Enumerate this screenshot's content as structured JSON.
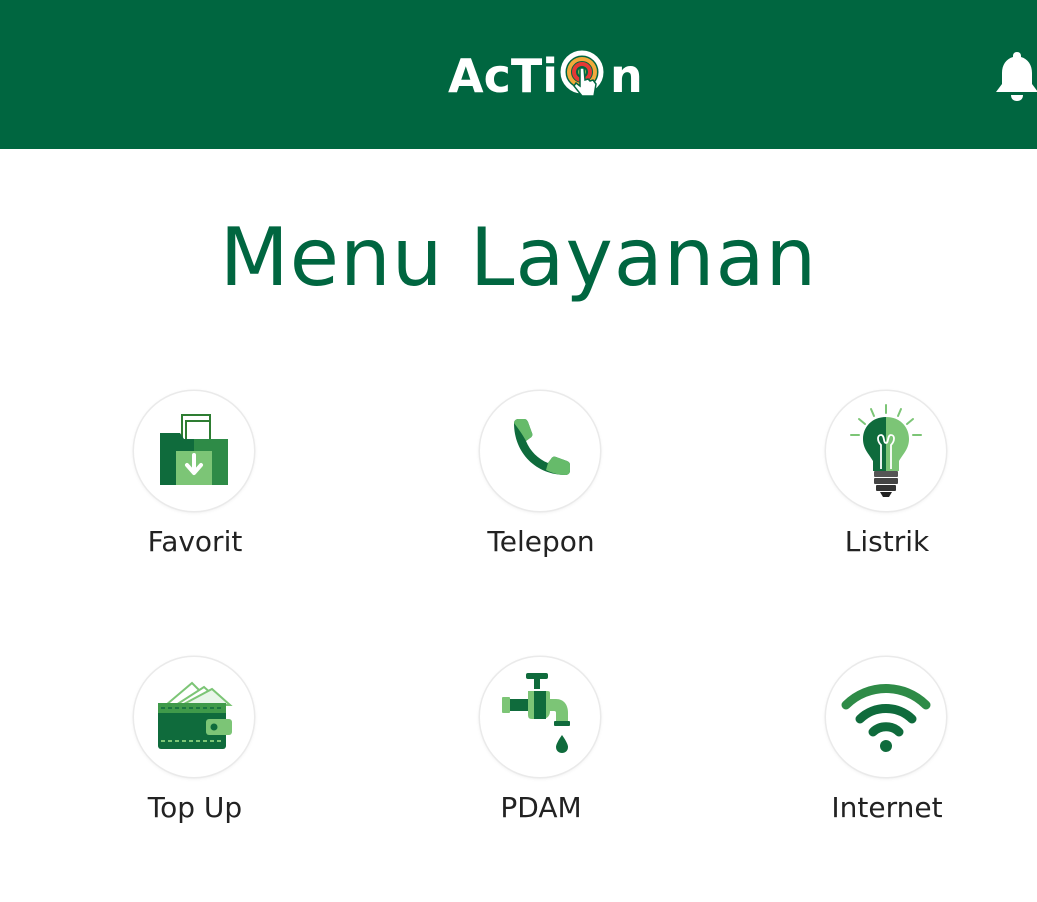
{
  "header": {
    "logo_text_start": "AcTi",
    "logo_text_end": "n",
    "brand_color": "#006640",
    "logo_icon": "target-hand-icon",
    "notification_icon": "bell-icon"
  },
  "page": {
    "title": "Menu Layanan"
  },
  "menu": {
    "items": [
      {
        "label": "Favorit",
        "icon": "folder-download-icon"
      },
      {
        "label": "Telepon",
        "icon": "phone-icon"
      },
      {
        "label": "Listrik",
        "icon": "lightbulb-icon"
      },
      {
        "label": "Top Up",
        "icon": "wallet-icon"
      },
      {
        "label": "PDAM",
        "icon": "water-tap-icon"
      },
      {
        "label": "Internet",
        "icon": "wifi-icon"
      }
    ]
  },
  "colors": {
    "dark_green": "#006640",
    "light_green": "#4caf50",
    "text": "#222222"
  }
}
